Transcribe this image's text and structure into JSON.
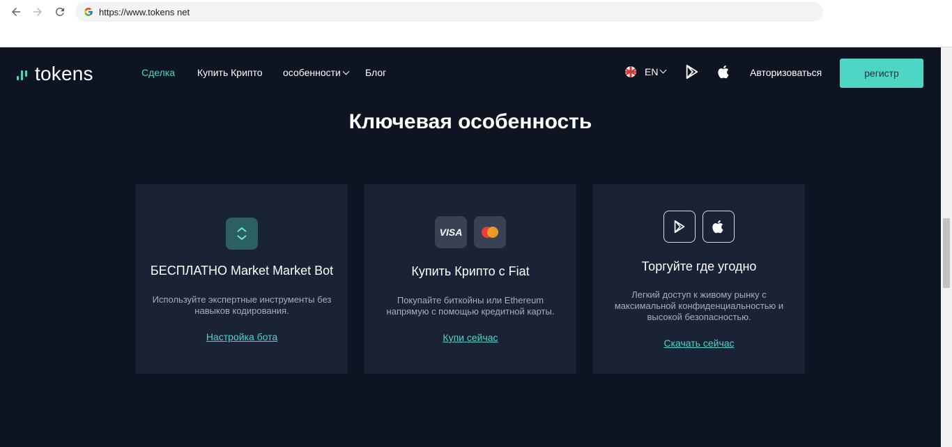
{
  "browser": {
    "url": "https://www.tokens net"
  },
  "header": {
    "logo_text": "tokens",
    "nav": [
      {
        "label": "Сделка",
        "active": true
      },
      {
        "label": "Купить Крипто"
      },
      {
        "label": "особенности"
      },
      {
        "label": "Блог"
      }
    ],
    "language": "EN",
    "login_label": "Авторизоваться",
    "register_label": "регистр"
  },
  "main": {
    "title": "Ключевая особенность",
    "cards": [
      {
        "title": "БЕСПЛАТНО Market Market Bot",
        "description": "Используйте экспертные инструменты без навыков кодирования.",
        "link": "Настройка бота",
        "icons": [
          "swap-icon"
        ]
      },
      {
        "title": "Купить Крипто с Fiat",
        "description": "Покупайте биткойны или Ethereum напрямую с помощью кредитной карты.",
        "link": "Купи сейчас",
        "icons": [
          "visa-icon",
          "mastercard-icon"
        ],
        "visa_text": "VISA"
      },
      {
        "title": "Торгуйте где угодно",
        "description": "Легкий доступ к живому рынку с максимальной конфиденциальностью и высокой безопасностью.",
        "link": "Скачать сейчас",
        "icons": [
          "google-play-icon",
          "apple-icon"
        ]
      }
    ]
  },
  "colors": {
    "accent": "#4ed6c5",
    "background": "#0f1423",
    "card": "#1a2236"
  }
}
